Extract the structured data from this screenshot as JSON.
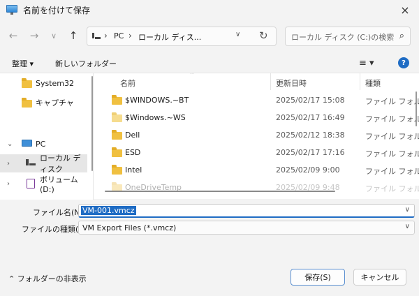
{
  "window": {
    "title": "名前を付けて保存",
    "close_icon": "×"
  },
  "nav_buttons": {
    "back": "←",
    "forward": "→",
    "recent": "∨",
    "up": "↑"
  },
  "address": {
    "crumbs": [
      "PC",
      "ローカル ディス..."
    ],
    "separator": "›",
    "dropdown": "∨",
    "refresh": "↻"
  },
  "search": {
    "placeholder": "ローカル ディスク (C:)の検索",
    "icon": "⌕"
  },
  "toolbar": {
    "organize": "整理 ▾",
    "new_folder": "新しいフォルダー",
    "view": "≡ ▾",
    "help": "?"
  },
  "sidebar": {
    "items": [
      {
        "label": "System32"
      },
      {
        "label": "キャプチャ"
      },
      {
        "label": "PC"
      },
      {
        "label": "ローカル ディスク"
      },
      {
        "label": "ボリューム (D:)"
      }
    ]
  },
  "columns": {
    "name": "名前",
    "date": "更新日時",
    "type": "種類"
  },
  "files": [
    {
      "name": "$WINDOWS.~BT",
      "date": "2025/02/17 15:08",
      "type": "ファイル フォルダー"
    },
    {
      "name": "$Windows.~WS",
      "date": "2025/02/17 16:49",
      "type": "ファイル フォルダー"
    },
    {
      "name": "Dell",
      "date": "2025/02/12 18:38",
      "type": "ファイル フォルダー"
    },
    {
      "name": "ESD",
      "date": "2025/02/17 17:16",
      "type": "ファイル フォルダー"
    },
    {
      "name": "Intel",
      "date": "2025/02/09 9:00",
      "type": "ファイル フォルダー"
    },
    {
      "name": "OneDriveTemp",
      "date": "2025/02/09 9:48",
      "type": "ファイル フォルダー"
    }
  ],
  "form": {
    "filename_label": "ファイル名(N):",
    "filename_value": "VM-001.vmcz",
    "filetype_label": "ファイルの種類(T):",
    "filetype_value": "VM Export Files (*.vmcz)",
    "dropdown": "∨"
  },
  "footer": {
    "hide_folders": "⌃  フォルダーの非表示",
    "save": "保存(S)",
    "cancel": "キャンセル"
  }
}
